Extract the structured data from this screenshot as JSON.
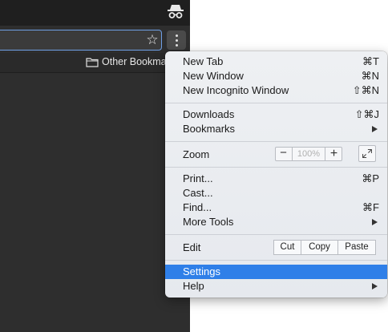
{
  "browser": {
    "bookmarks_bar": {
      "other_bookmarks": "Other Bookmarks"
    }
  },
  "menu": {
    "new_tab": {
      "label": "New Tab",
      "shortcut": "⌘T"
    },
    "new_window": {
      "label": "New Window",
      "shortcut": "⌘N"
    },
    "new_incognito": {
      "label": "New Incognito Window",
      "shortcut": "⇧⌘N"
    },
    "downloads": {
      "label": "Downloads",
      "shortcut": "⇧⌘J"
    },
    "bookmarks": {
      "label": "Bookmarks"
    },
    "zoom": {
      "label": "Zoom",
      "minus": "−",
      "value": "100%",
      "plus": "+"
    },
    "print": {
      "label": "Print...",
      "shortcut": "⌘P"
    },
    "cast": {
      "label": "Cast..."
    },
    "find": {
      "label": "Find...",
      "shortcut": "⌘F"
    },
    "more_tools": {
      "label": "More Tools"
    },
    "edit": {
      "label": "Edit",
      "cut": "Cut",
      "copy": "Copy",
      "paste": "Paste"
    },
    "settings": {
      "label": "Settings",
      "selected": true
    },
    "help": {
      "label": "Help"
    }
  },
  "colors": {
    "selection": "#2f7fe8",
    "menu_bg": "#eef0f3",
    "browser_bg": "#2e2e2e",
    "omnibox_focus": "#6fa0e6"
  },
  "icons": {
    "incognito": "incognito-icon",
    "star": "bookmark-star-icon",
    "menu": "three-dots-vertical-icon",
    "folder": "folder-icon",
    "fullscreen": "fullscreen-icon",
    "submenu": "submenu-arrow-icon"
  }
}
